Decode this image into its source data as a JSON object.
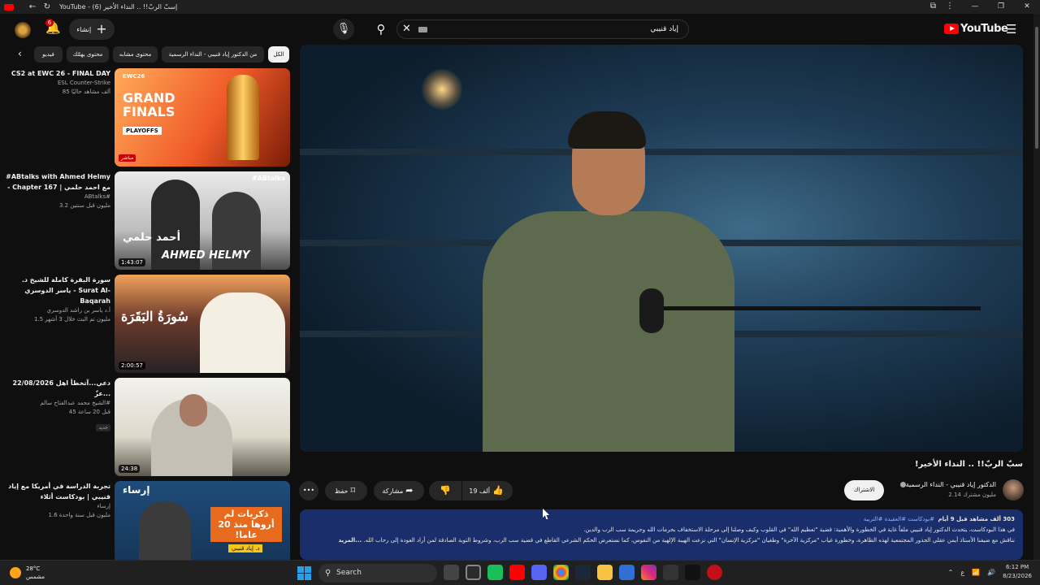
{
  "browser": {
    "tab_title": "YouTube - (6) إسبّ الربّ!! .. النداء الأخير",
    "back": "←",
    "reload": "↻",
    "window_controls": [
      "—",
      "❐",
      "✕"
    ]
  },
  "masthead": {
    "logo_text": "YouTube",
    "search_value": "إياد قنيبي",
    "create_label": "إنشاء",
    "notification_count": "6"
  },
  "chips": [
    "الكل",
    "من الدكتور إياد قنيبي - النداء الرسمية",
    "محتوى مشابه",
    "محتوى يهمّك",
    "فيديو"
  ],
  "recommendations": [
    {
      "title": "CS2 at EWC 26 - FINAL DAY",
      "channel": "ESL Counter-Strike",
      "stats": "85 ألف مشاهد حاليًا",
      "badge": "مباشر",
      "thumb_text": "GRAND FINALS",
      "thumb_sub": "PLAYOFFS",
      "thumb_brand": "EWC26"
    },
    {
      "title": "#ABtalks with Ahmed Helmy - Chapter 167 | مع احمد حلمي",
      "channel": "ABtalks#",
      "stats": "3.2 مليون  قبل سنتين",
      "duration": "1:43:07",
      "thumb_text": "AHMED HELMY",
      "thumb_ar": "أحمد حلمي",
      "thumb_tag": "#ABtalks"
    },
    {
      "title": "سورة البقرة كاملة للشيخ د. ياسر الدوسري - Surat Al-Baqarah",
      "channel": "أ.د ياسر بن راشد الدوسري",
      "stats": "1.5 مليون  تم البث خلال 3 أشهر",
      "duration": "2:00:57",
      "thumb_text": "سُورَةُ البَقَرَة"
    },
    {
      "title": "22/08/2026 دعي...آتخطأ اهل عزّ...",
      "channel": "الشيخ محمد عبدالفتاح سالم#",
      "stats": "45  قبل 20 ساعة",
      "badge": "جديد",
      "duration": "24:38"
    },
    {
      "title": "تجربة الدراسة في أمريكا مع إياد قنيبي | بودكاست أثلاء",
      "channel": "إرساء",
      "stats": "1.6 مليون  قبل سنة واحدة",
      "thumb_brand": "إرساء",
      "thumb_text": "ذكريات لم أروها منذ 20 عاما!",
      "thumb_sub": "د. إياد قنيبي"
    }
  ],
  "video": {
    "title": "سبّ الربّ!! .. النداء الأخير!",
    "channel_name": "الدكتور إياد قنيبي - النداء الرسمية",
    "subscribers": "2.14 مليون مشترك",
    "subscribe_label": "الاشتراك",
    "likes": "19 ألف",
    "share_label": "مشاركة",
    "save_label": "حفظ",
    "more_label": "•••"
  },
  "description": {
    "stats": "303 ألف مشاهد  قبل 9 أيام",
    "tags": "#بودكاست #العقيدة #التربية",
    "line1": "في هذا البودكاست، يتحدث الدكتور إياد قنيبي ملفاً غاية في الخطورة والأهمية: قضية \"تعظيم الله\" في القلوب وكيف وصلنا إلى مرحلة الاستخفاف بحرمات الله وجريمة سب الرب والدين.",
    "line2": "نناقش مع ضيفنا الأستاذ أيمن عقلي الجذور المجتمعية لهذه الظاهرة، وخطورة غياب \"مركزية الآخرة\" وطغيان \"مركزية الإنسان\" التي نزعت الهيبة الإلهية من النفوس، كما نستعرض الحكم الشرعي القاطع في قضية سب الرب، وشروط التوبة الصادقة لمن أراد العودة إلى رحاب الله.",
    "more": "...المزيد"
  },
  "taskbar": {
    "temperature": "28°C",
    "condition": "مشمس",
    "search_label": "Search",
    "time": "6:12 PM",
    "date": "8/23/2026",
    "lang": "ع"
  }
}
